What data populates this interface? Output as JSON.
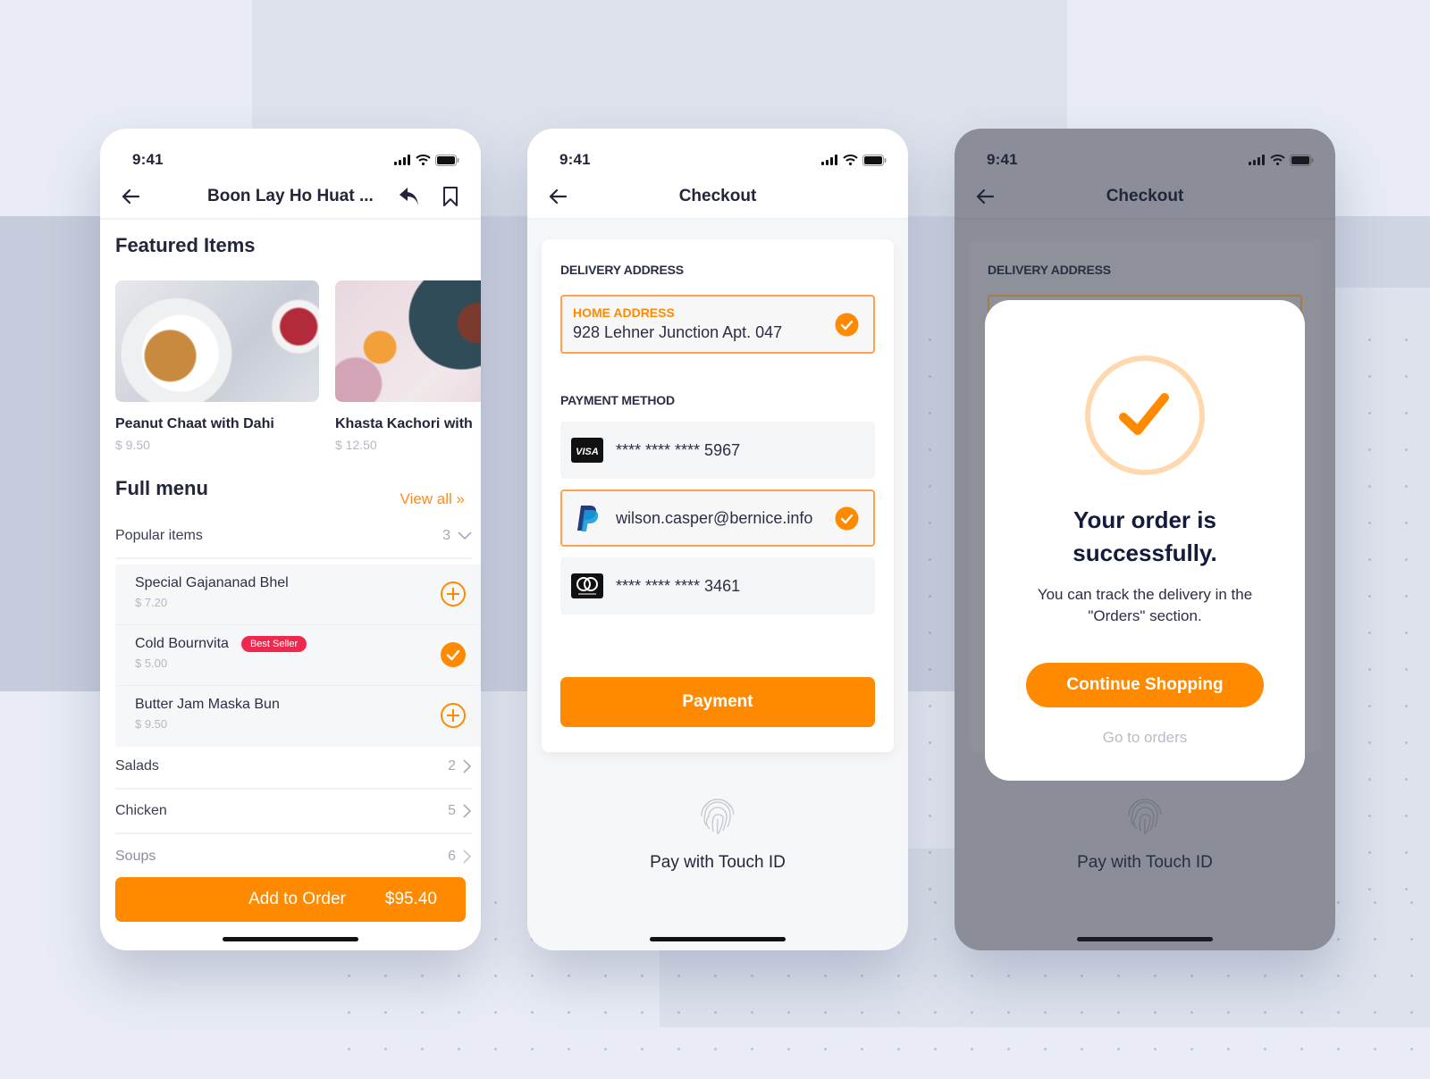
{
  "colors": {
    "accent": "#ff8a00",
    "badge": "#f0284e",
    "text_dark": "#23253a",
    "muted": "#b4b8c4",
    "overlay": "#8b8e98"
  },
  "status_bar": {
    "time": "9:41",
    "icons": [
      "signal-icon",
      "wifi-icon",
      "battery-icon"
    ]
  },
  "screen_menu": {
    "header": {
      "title": "Boon Lay Ho Huat ...",
      "back_icon": "arrow-left-icon",
      "actions": [
        "share-reply-icon",
        "bookmark-icon"
      ]
    },
    "featured_title": "Featured Items",
    "featured_items": [
      {
        "name": "Peanut Chaat with Dahi",
        "price": "$ 9.50"
      },
      {
        "name": "Khasta Kachori with",
        "price": "$ 12.50"
      }
    ],
    "full_menu_title": "Full menu",
    "view_all": "View all »",
    "categories": [
      {
        "name": "Popular items",
        "count": "3",
        "expanded": true
      },
      {
        "name": "Salads",
        "count": "2",
        "expanded": false
      },
      {
        "name": "Chicken",
        "count": "5",
        "expanded": false
      },
      {
        "name": "Soups",
        "count": "6",
        "expanded": false
      }
    ],
    "popular_items": [
      {
        "name": "Special Gajananad Bhel",
        "price": "$ 7.20",
        "badge": "",
        "state": "add"
      },
      {
        "name": "Cold Bournvita",
        "price": "$ 5.00",
        "badge": "Best Seller",
        "state": "added"
      },
      {
        "name": "Butter Jam Maska Bun",
        "price": "$ 9.50",
        "badge": "",
        "state": "add"
      }
    ],
    "order_button": {
      "label": "Add to Order",
      "total": "$95.40"
    }
  },
  "screen_checkout": {
    "header": {
      "title": "Checkout",
      "back_icon": "arrow-left-icon"
    },
    "delivery_label": "DELIVERY ADDRESS",
    "address": {
      "tag": "HOME ADDRESS",
      "text": "928 Lehner Junction Apt. 047",
      "selected": true
    },
    "payment_label": "PAYMENT METHOD",
    "payment_methods": [
      {
        "type": "visa",
        "icon": "visa-icon",
        "text": "**** **** **** 5967",
        "selected": false
      },
      {
        "type": "paypal",
        "icon": "paypal-icon",
        "text": "wilson.casper@bernice.info",
        "selected": true
      },
      {
        "type": "mastercard",
        "icon": "mastercard-icon",
        "text": "**** **** **** 3461",
        "selected": false
      }
    ],
    "payment_button": "Payment",
    "touch_id_label": "Pay with Touch ID",
    "visa_glyph": "VISA"
  },
  "screen_success": {
    "header": {
      "title": "Checkout"
    },
    "delivery_label": "DELIVERY ADDRESS",
    "modal": {
      "title_line1": "Your order is",
      "title_line2": "successfully.",
      "desc_line1": "You can track the delivery in the",
      "desc_line2": "\"Orders\" section.",
      "continue_button": "Continue Shopping",
      "goto_orders": "Go to orders"
    },
    "touch_id_label": "Pay with Touch ID"
  }
}
